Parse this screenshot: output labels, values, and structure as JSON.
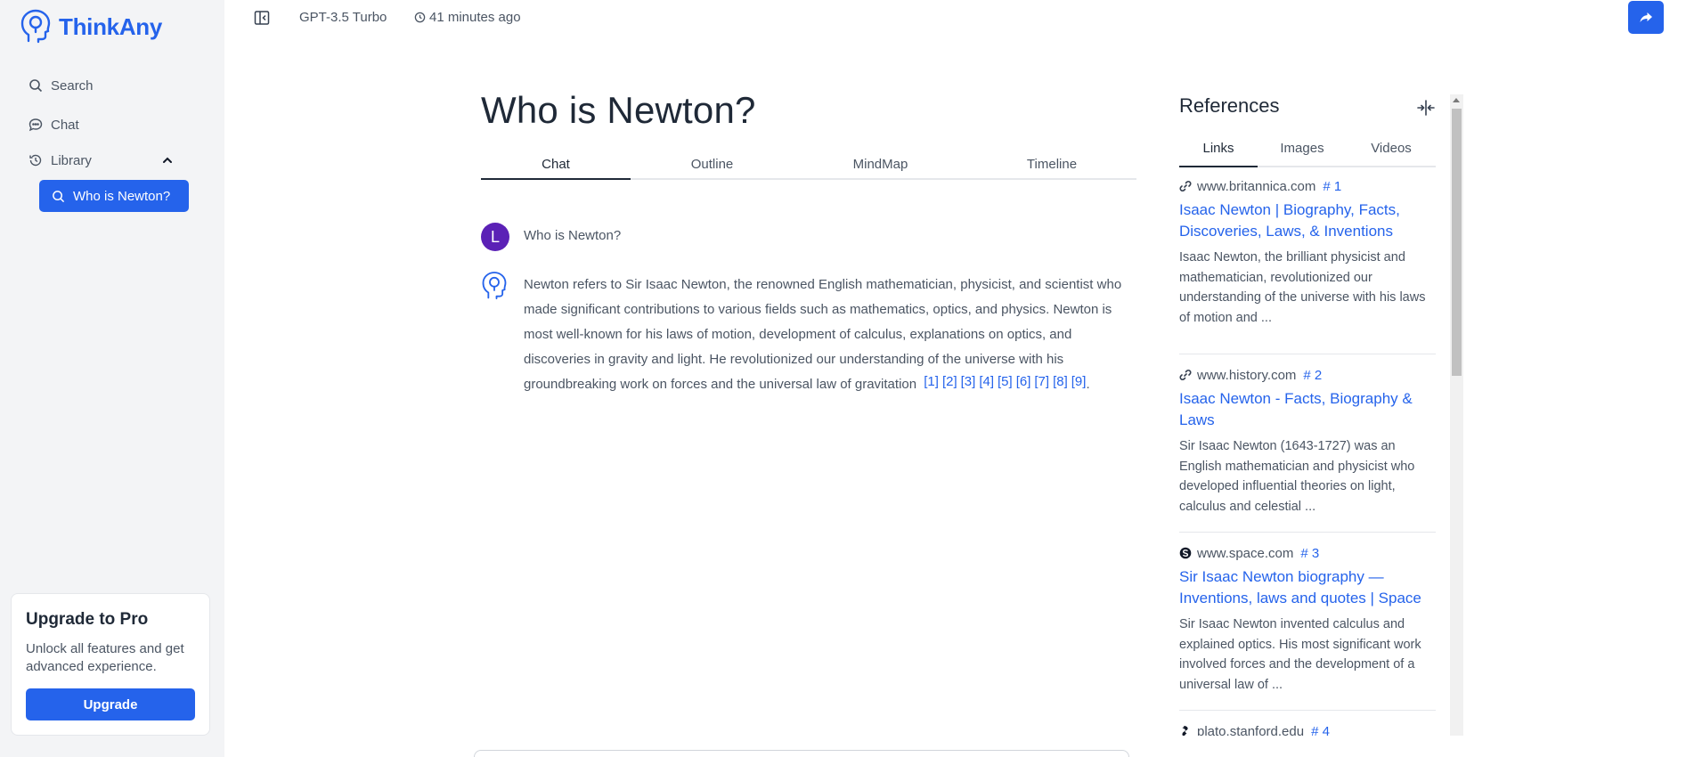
{
  "sidebar": {
    "brand": "ThinkAny",
    "nav": {
      "search": "Search",
      "chat": "Chat",
      "library": "Library"
    },
    "library_items": [
      {
        "label": "Who is Newton?"
      }
    ],
    "upgrade": {
      "title": "Upgrade to Pro",
      "description": "Unlock all features and get advanced experience.",
      "button": "Upgrade"
    }
  },
  "topbar": {
    "model": "GPT-3.5 Turbo",
    "time_ago": "41 minutes ago"
  },
  "main": {
    "title": "Who is Newton?",
    "tabs": [
      "Chat",
      "Outline",
      "MindMap",
      "Timeline"
    ],
    "active_tab": "Chat",
    "user": {
      "avatar_letter": "L",
      "question": "Who is Newton?"
    },
    "answer": {
      "text": "Newton refers to Sir Isaac Newton, the renowned English mathematician, physicist, and scientist who made significant contributions to various fields such as mathematics, optics, and physics. Newton is most well-known for his laws of motion, development of calculus, explanations on optics, and discoveries in gravity and light. He revolutionized our understanding of the universe with his groundbreaking work on forces and the universal law of gravitation",
      "citations": [
        "[1]",
        "[2]",
        "[3]",
        "[4]",
        "[5]",
        "[6]",
        "[7]",
        "[8]",
        "[9]"
      ],
      "end": "."
    }
  },
  "references": {
    "title": "References",
    "tabs": [
      "Links",
      "Images",
      "Videos"
    ],
    "active_tab": "Links",
    "items": [
      {
        "domain": "www.britannica.com",
        "number": "# 1",
        "icon": "link-icon",
        "title": "Isaac Newton | Biography, Facts, Discoveries, Laws, & Inventions",
        "snippet": "Isaac Newton, the brilliant physicist and mathematician, revolutionized our understanding of the universe with his laws of motion and ..."
      },
      {
        "domain": "www.history.com",
        "number": "# 2",
        "icon": "link-icon",
        "title": "Isaac Newton - Facts, Biography & Laws",
        "snippet": "Sir Isaac Newton (1643-1727) was an English mathematician and physicist who developed influential theories on light, calculus and celestial ..."
      },
      {
        "domain": "www.space.com",
        "number": "# 3",
        "icon": "space-logo-icon",
        "title": "Sir Isaac Newton biography — Inventions, laws and quotes | Space",
        "snippet": "Sir Isaac Newton invented calculus and explained optics. His most significant work involved forces and the development of a universal law of ..."
      },
      {
        "domain": "plato.stanford.edu",
        "number": "# 4",
        "icon": "stanford-logo-icon"
      }
    ]
  },
  "colors": {
    "accent": "#2563eb",
    "sidebar_bg": "#f3f4f6",
    "avatar": "#5b21b6"
  }
}
